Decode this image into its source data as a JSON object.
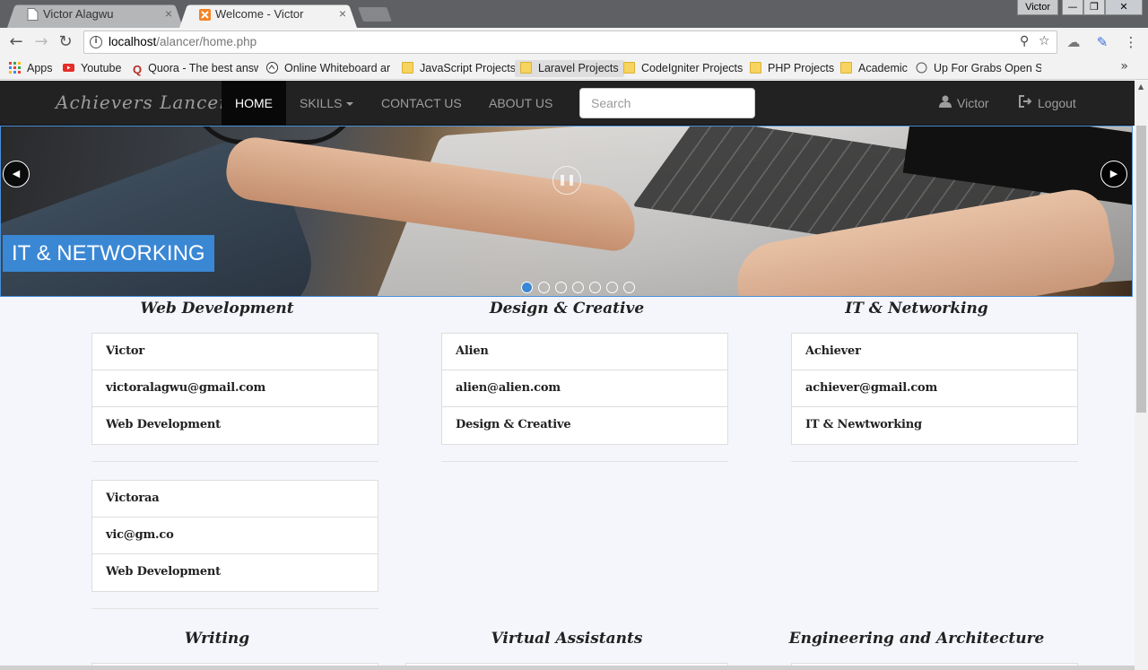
{
  "browser": {
    "tabs": [
      {
        "title": "Victor Alagwu",
        "close": "×"
      },
      {
        "title": "Welcome - Victor",
        "close": "×"
      }
    ],
    "profile_name": "Victor",
    "window_controls": {
      "minimize": "—",
      "restore": "❐",
      "close": "✕"
    },
    "url_host": "localhost",
    "url_path": "/alancer/home.php",
    "bookmarks": [
      {
        "label": "Apps",
        "icon": "apps-grid-icon"
      },
      {
        "label": "Youtube",
        "icon": "youtube-icon"
      },
      {
        "label": "Quora - The best answ",
        "icon": "quora-icon"
      },
      {
        "label": "Online Whiteboard ar",
        "icon": "whiteboard-icon"
      },
      {
        "label": "JavaScript Projects",
        "icon": "folder-icon"
      },
      {
        "label": "Laravel Projects",
        "icon": "folder-icon"
      },
      {
        "label": "CodeIgniter Projects",
        "icon": "folder-icon"
      },
      {
        "label": "PHP Projects",
        "icon": "folder-icon"
      },
      {
        "label": "Academic",
        "icon": "folder-icon"
      },
      {
        "label": "Up For Grabs Open So",
        "icon": "globe-icon"
      }
    ],
    "bookmarks_more": "»"
  },
  "nav": {
    "brand": "Achievers Lancer",
    "home": "HOME",
    "skills": "SKILLS",
    "contact": "CONTACT US",
    "about": "ABOUT US",
    "search_placeholder": "Search",
    "user": "Victor",
    "logout": "Logout"
  },
  "carousel": {
    "caption": "IT & NETWORKING",
    "slide_count": 7,
    "active_slide": 1
  },
  "categories": [
    {
      "title": "Web Development",
      "entries": [
        {
          "name": "Victor",
          "email": "victoralagwu@gmail.com",
          "skill": "Web Development"
        },
        {
          "name": "Victoraa",
          "email": "vic@gm.co",
          "skill": "Web Development"
        }
      ]
    },
    {
      "title": "Design & Creative",
      "entries": [
        {
          "name": "Alien",
          "email": "alien@alien.com",
          "skill": "Design & Creative"
        }
      ]
    },
    {
      "title": "IT & Networking",
      "entries": [
        {
          "name": "Achiever",
          "email": "achiever@gmail.com",
          "skill": "IT & Newtworking"
        }
      ]
    }
  ],
  "lower_categories": [
    "Writing",
    "Virtual Assistants",
    "Engineering and Architecture"
  ]
}
